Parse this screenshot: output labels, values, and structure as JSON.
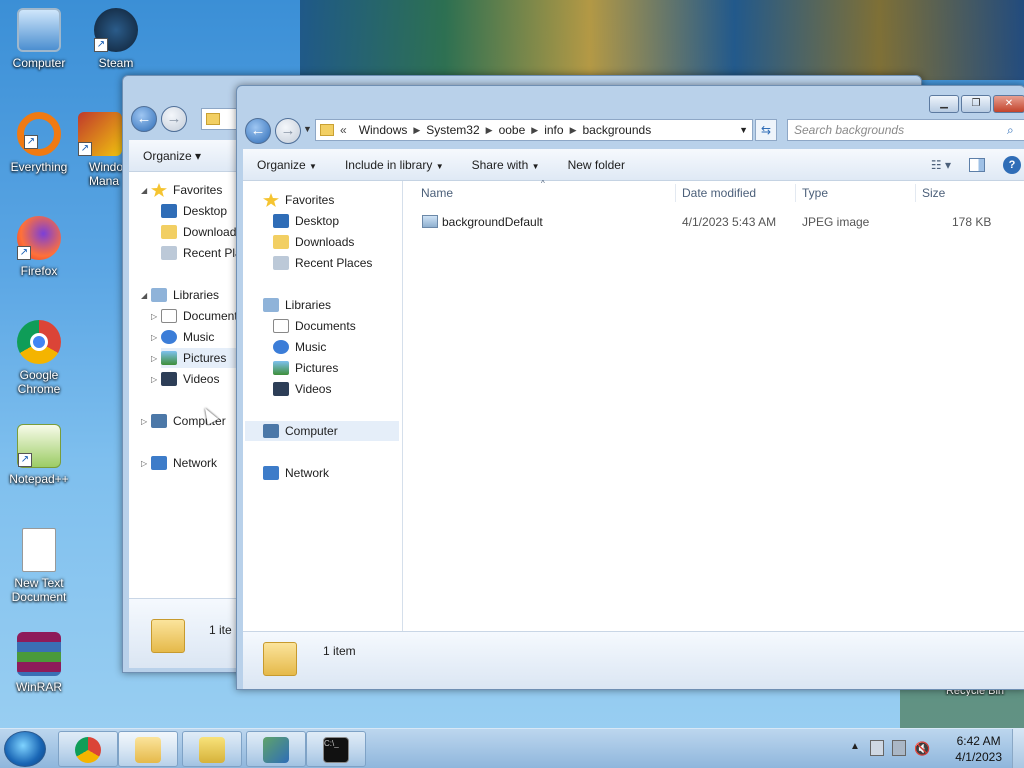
{
  "desktop": {
    "icons": [
      {
        "label": "Computer",
        "icon": "computer-icon"
      },
      {
        "label": "Steam",
        "icon": "steam-icon"
      },
      {
        "label": "Everything",
        "icon": "everything-icon"
      },
      {
        "label": "Windo Mana",
        "icon": "windows-manager-icon"
      },
      {
        "label": "Firefox",
        "icon": "firefox-icon"
      },
      {
        "label": "Google Chrome",
        "icon": "chrome-icon"
      },
      {
        "label": "Notepad++",
        "icon": "notepadpp-icon"
      },
      {
        "label": "New Text Document",
        "icon": "text-document-icon"
      },
      {
        "label": "WinRAR",
        "icon": "winrar-icon"
      },
      {
        "label": "Recycle Bin",
        "icon": "recycle-bin-icon"
      }
    ]
  },
  "back_window": {
    "toolbar": {
      "organize": "Organize ▾"
    },
    "nav": {
      "favorites": "Favorites",
      "desktop": "Desktop",
      "downloads": "Download",
      "recent": "Recent Pla",
      "libraries": "Libraries",
      "documents": "Document",
      "music": "Music",
      "pictures": "Pictures",
      "videos": "Videos",
      "computer": "Computer",
      "network": "Network"
    },
    "status": "1 ite"
  },
  "front_window": {
    "address": {
      "crumbs": [
        "Windows",
        "System32",
        "oobe",
        "info",
        "backgrounds"
      ],
      "prefix": "«"
    },
    "search_placeholder": "Search backgrounds",
    "toolbar": {
      "organize": "Organize",
      "include": "Include in library",
      "share": "Share with",
      "newfolder": "New folder"
    },
    "nav": {
      "favorites": "Favorites",
      "desktop": "Desktop",
      "downloads": "Downloads",
      "recent": "Recent Places",
      "libraries": "Libraries",
      "documents": "Documents",
      "music": "Music",
      "pictures": "Pictures",
      "videos": "Videos",
      "computer": "Computer",
      "network": "Network"
    },
    "columns": {
      "name": "Name",
      "date": "Date modified",
      "type": "Type",
      "size": "Size"
    },
    "files": [
      {
        "name": "backgroundDefault",
        "date": "4/1/2023 5:43 AM",
        "type": "JPEG image",
        "size": "178 KB"
      }
    ],
    "status": "1 item"
  },
  "taskbar": {
    "time": "6:42 AM",
    "date": "4/1/2023"
  },
  "colors": {
    "accent": "#2f6db7",
    "window_frame": "#b9d1ea",
    "taskbar": "#8fb6dc"
  }
}
